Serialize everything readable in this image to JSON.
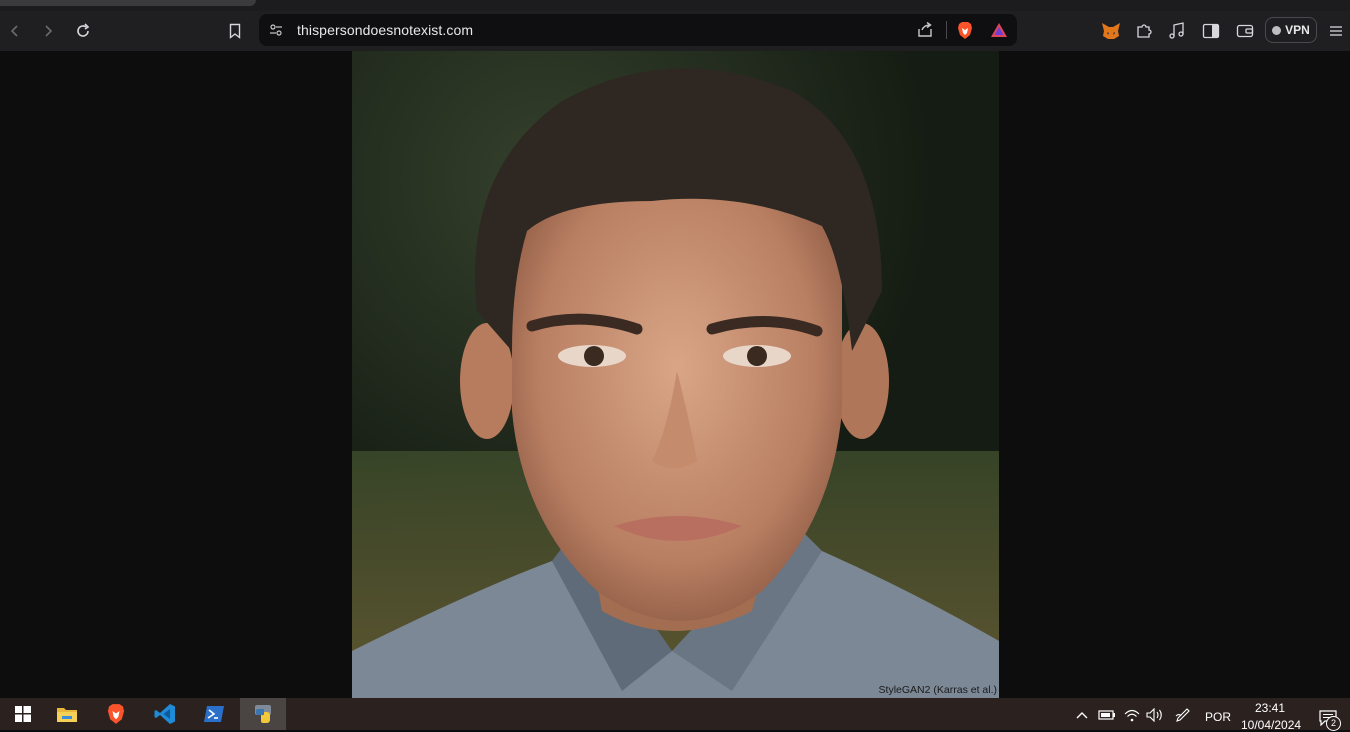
{
  "browser": {
    "url": "thispersondoesnotexist.com",
    "vpn_label": "VPN",
    "icons": [
      "back-icon",
      "forward-icon",
      "reload-icon",
      "bookmark-icon",
      "site-settings-icon",
      "share-icon",
      "brave-shields-icon",
      "brave-rewards-icon",
      "metamask-icon",
      "extensions-icon",
      "media-icon",
      "sidebar-icon",
      "wallet-icon",
      "menu-icon"
    ]
  },
  "page": {
    "image_alt": "Generated face of a young man",
    "credit": "StyleGAN2 (Karras et al.)"
  },
  "taskbar": {
    "apps": [
      "start-icon",
      "file-explorer-icon",
      "brave-icon",
      "vscode-icon",
      "powershell-icon",
      "python-icon"
    ],
    "language": "POR",
    "time": "23:41",
    "date": "10/04/2024",
    "notifications": "2"
  },
  "colors": {
    "toolbar": "#1f1f22",
    "urlbar": "#0f0f11",
    "taskbar": "#2b2220",
    "brave_orange": "#fb542b"
  }
}
